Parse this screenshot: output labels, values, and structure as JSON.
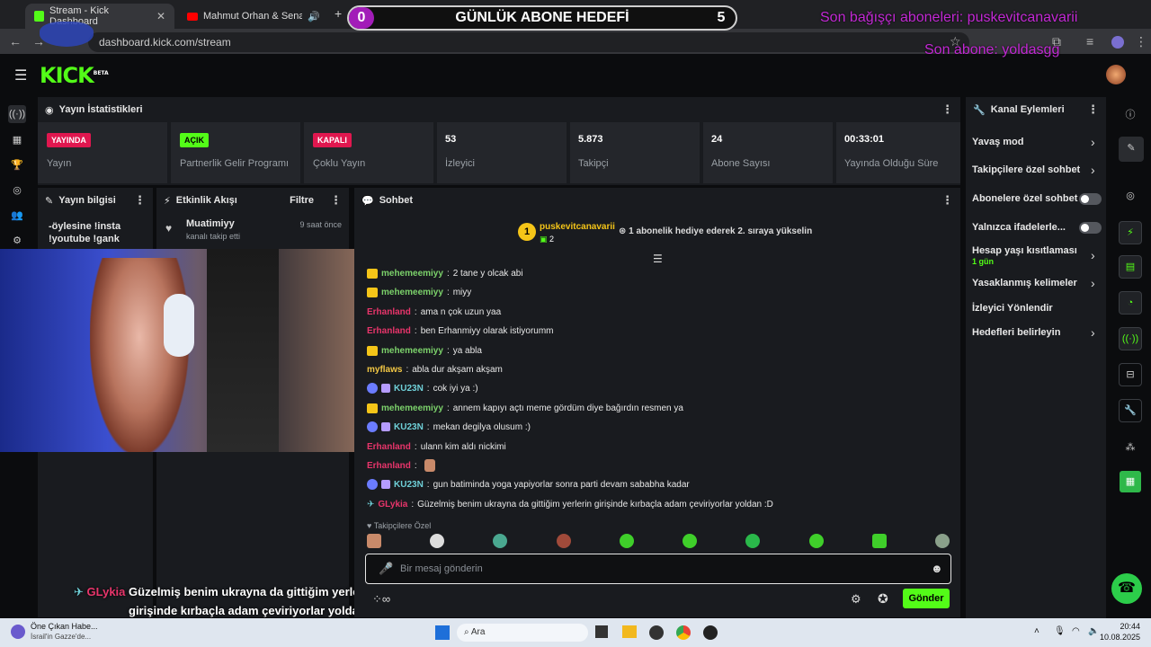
{
  "browser": {
    "tabs": [
      {
        "title": "Stream - Kick Dashboard",
        "active": true
      },
      {
        "title": "Mahmut Orhan & Sena Sener",
        "active": false
      }
    ],
    "url": "dashboard.kick.com/stream"
  },
  "overlay": {
    "goal_left": "0",
    "goal_label": "GÜNLÜK ABONE HEDEFİ",
    "goal_right": "5",
    "last_donor": "Son bağışçı aboneleri: puskevitcanavarii",
    "last_sub": "Son abone: yoldasgg",
    "subtitle_user": "GLykia",
    "subtitle_line1": "Güzelmiş benim ukrayna da gittiğim yerlerin",
    "subtitle_line2": "girişinde kırbaçla adam çeviriyorlar yoldan :D"
  },
  "header": {
    "logo": "KICK",
    "logo_tag": "BETA"
  },
  "stats": {
    "title": "Yayın İstatistikleri",
    "items": [
      {
        "badge": "YAYINDA",
        "label": "Yayın"
      },
      {
        "badge": "AÇIK",
        "label": "Partnerlik Gelir Programı"
      },
      {
        "badge": "KAPALI",
        "label": "Çoklu Yayın"
      },
      {
        "value": "53",
        "label": "İzleyici"
      },
      {
        "value": "5.873",
        "label": "Takipçi"
      },
      {
        "value": "24",
        "label": "Abone Sayısı"
      },
      {
        "value": "00:33:01",
        "label": "Yayında Olduğu Süre"
      }
    ]
  },
  "stream_info": {
    "title": "Yayın bilgisi",
    "text": "-öylesine !insta !youtube !gank"
  },
  "activity": {
    "title": "Etkinlik Akışı",
    "filter": "Filtre",
    "item_user": "Muatimiyy",
    "item_action": "kanalı takip etti",
    "item_time": "9 saat önce"
  },
  "chat": {
    "title": "Sohbet",
    "pinned_user": "puskevitcanavarii",
    "pinned_rank": "1",
    "pinned_count": "2",
    "pinned_text": "1 abonelik hediye ederek 2. sıraya yükselin",
    "messages": [
      {
        "user": "mehemeemiyy",
        "text": "2 tane y olcak abi",
        "color": "#7cd26b"
      },
      {
        "user": "mehemeemiyy",
        "text": "miyy",
        "color": "#7cd26b"
      },
      {
        "user": "Erhanland",
        "text": "ama n çok uzun yaa",
        "color": "#e8356b"
      },
      {
        "user": "Erhanland",
        "text": "ben Erhanmiyy olarak istiyorumm",
        "color": "#e8356b"
      },
      {
        "user": "mehemeemiyy",
        "text": "ya abla",
        "color": "#7cd26b"
      },
      {
        "user": "myflaws",
        "text": "abla dur akşam akşam",
        "color": "#f2c744"
      },
      {
        "user": "KU23N",
        "text": "cok iyi ya :)",
        "color": "#6fd0d8"
      },
      {
        "user": "mehemeemiyy",
        "text": "annem kapıyı açtı meme gördüm diye bağırdın resmen ya",
        "color": "#7cd26b"
      },
      {
        "user": "KU23N",
        "text": "mekan degilya olusum :)",
        "color": "#6fd0d8"
      },
      {
        "user": "Erhanland",
        "text": "ulann kim aldı nickimi",
        "color": "#e8356b"
      },
      {
        "user": "Erhanland",
        "text": "",
        "color": "#e8356b"
      },
      {
        "user": "KU23N",
        "text": "gun batiminda yoga yapiyorlar sonra parti devam sababha kadar",
        "color": "#6fd0d8"
      },
      {
        "user": "GLykia",
        "text": "Güzelmiş benim ukrayna da gittiğim yerlerin girişinde kırbaçla adam çeviriyorlar yoldan :D",
        "color": "#e8356b"
      }
    ],
    "followers_only": "Takipçilere Özel",
    "input_placeholder": "Bir mesaj gönderin",
    "send_label": "Gönder"
  },
  "channel_actions": {
    "title": "Kanal Eylemleri",
    "items": [
      {
        "label": "Yavaş mod"
      },
      {
        "label": "Takipçilere özel sohbet"
      },
      {
        "label": "Abonelere özel sohbet"
      },
      {
        "label": "Yalnızca ifadelerle..."
      },
      {
        "label": "Hesap yaşı kısıtlaması",
        "sub": "1 gün"
      },
      {
        "label": "Yasaklanmış kelimeler"
      },
      {
        "label": "İzleyici Yönlendir"
      },
      {
        "label": "Hedefleri belirleyin"
      }
    ]
  },
  "taskbar": {
    "news_title": "Öne Çıkan Habe...",
    "news_sub": "İsrail'in Gazze'de...",
    "search": "Ara",
    "time": "20:44",
    "date": "10.08.2025"
  }
}
